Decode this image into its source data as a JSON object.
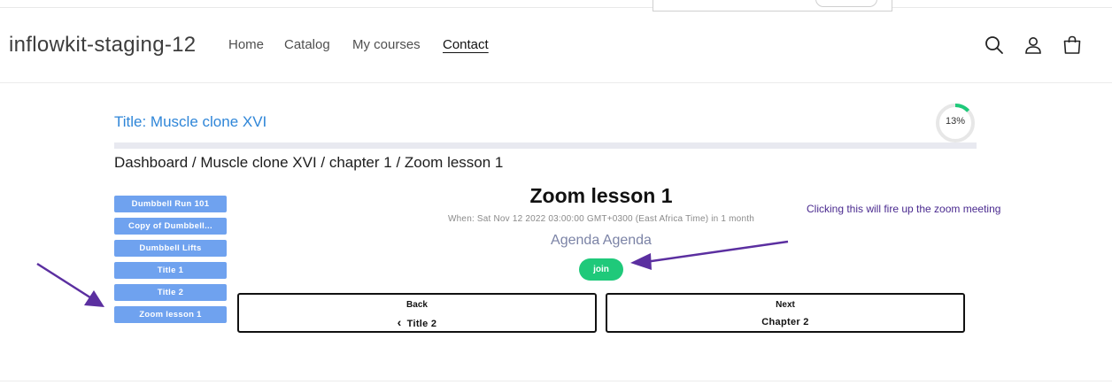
{
  "header": {
    "site_title": "inflowkit-staging-12",
    "nav": [
      "Home",
      "Catalog",
      "My courses",
      "Contact"
    ],
    "active_nav": "Contact",
    "icons": [
      "search-icon",
      "account-icon",
      "cart-icon"
    ]
  },
  "course": {
    "title": "Title: Muscle clone XVI",
    "progress_text": "13%",
    "progress_fraction": 0.13,
    "breadcrumb": "Dashboard / Muscle clone XVI / chapter 1 / Zoom lesson 1"
  },
  "sidebar": {
    "items": [
      "Dumbbell Run 101",
      "Copy of Dumbbell...",
      "Dumbbell Lifts",
      "Title 1",
      "Title 2",
      "Zoom lesson 1"
    ]
  },
  "lesson": {
    "title": "Zoom lesson 1",
    "when": "When: Sat Nov 12 2022 03:00:00 GMT+0300 (East Africa Time) in 1 month",
    "agenda": "Agenda Agenda",
    "join_label": "join"
  },
  "navigation": {
    "back_label": "Back",
    "back_target": "Title 2",
    "back_chevron": "‹",
    "next_label": "Next",
    "next_target": "Chapter 2"
  },
  "annotation": {
    "note": "Clicking this will fire up the zoom meeting",
    "arrow_color": "#5b2fa0"
  },
  "colors": {
    "accent_blue": "#2f86d8",
    "sidebar_button": "#6fa2ef",
    "join_green": "#1fc97a",
    "progress_green": "#1fc97a"
  }
}
